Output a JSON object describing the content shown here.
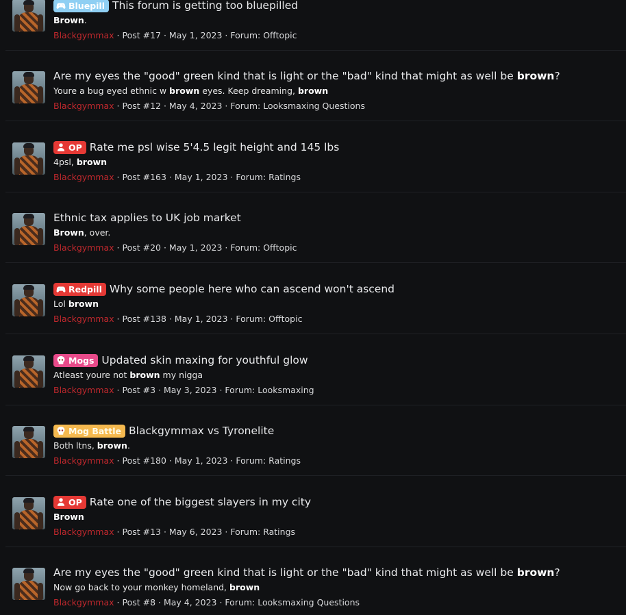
{
  "results": [
    {
      "prefix": {
        "label": "Bluepill",
        "icon": "gamepad-icon",
        "style": "bluepill",
        "color": "#8fcff3"
      },
      "title_parts": [
        {
          "text": "This forum is getting too bluepilled",
          "bold": false
        }
      ],
      "snippet_parts": [
        {
          "text": "Brown",
          "bold": true
        },
        {
          "text": ".",
          "bold": false
        }
      ],
      "author": "Blackgymmax",
      "post": "Post #17",
      "date": "May 1, 2023",
      "forum_label": "Forum:",
      "forum": "Offtopic"
    },
    {
      "prefix": null,
      "title_parts": [
        {
          "text": "Are my eyes the \"good\" green kind that is light or the \"bad\" kind that might as well be ",
          "bold": false
        },
        {
          "text": "brown",
          "bold": true
        },
        {
          "text": "?",
          "bold": false
        }
      ],
      "snippet_parts": [
        {
          "text": "Youre a bug eyed ethnic w ",
          "bold": false
        },
        {
          "text": "brown",
          "bold": true
        },
        {
          "text": " eyes. Keep dreaming, ",
          "bold": false
        },
        {
          "text": "brown",
          "bold": true
        }
      ],
      "author": "Blackgymmax",
      "post": "Post #12",
      "date": "May 4, 2023",
      "forum_label": "Forum:",
      "forum": "Looksmaxing Questions"
    },
    {
      "prefix": {
        "label": "OP",
        "icon": "user-icon",
        "style": "op",
        "color": "#e53935"
      },
      "title_parts": [
        {
          "text": "Rate me psl wise 5'4.5 legit height and 145 lbs",
          "bold": false
        }
      ],
      "snippet_parts": [
        {
          "text": "4psl, ",
          "bold": false
        },
        {
          "text": "brown",
          "bold": true
        }
      ],
      "author": "Blackgymmax",
      "post": "Post #163",
      "date": "May 1, 2023",
      "forum_label": "Forum:",
      "forum": "Ratings"
    },
    {
      "prefix": null,
      "title_parts": [
        {
          "text": "Ethnic tax applies to UK job market",
          "bold": false
        }
      ],
      "snippet_parts": [
        {
          "text": "Brown",
          "bold": true
        },
        {
          "text": ", over.",
          "bold": false
        }
      ],
      "author": "Blackgymmax",
      "post": "Post #20",
      "date": "May 1, 2023",
      "forum_label": "Forum:",
      "forum": "Offtopic"
    },
    {
      "prefix": {
        "label": "Redpill",
        "icon": "gamepad-icon",
        "style": "redpill",
        "color": "#e53935"
      },
      "title_parts": [
        {
          "text": "Why some people here who can ascend won't ascend",
          "bold": false
        }
      ],
      "snippet_parts": [
        {
          "text": "Lol ",
          "bold": false
        },
        {
          "text": "brown",
          "bold": true
        }
      ],
      "author": "Blackgymmax",
      "post": "Post #138",
      "date": "May 1, 2023",
      "forum_label": "Forum:",
      "forum": "Offtopic"
    },
    {
      "prefix": {
        "label": "Mogs",
        "icon": "skull-icon",
        "style": "mogs",
        "color": "#e84a8a"
      },
      "title_parts": [
        {
          "text": "Updated skin maxing for youthful glow",
          "bold": false
        }
      ],
      "snippet_parts": [
        {
          "text": "Atleast youre not ",
          "bold": false
        },
        {
          "text": "brown",
          "bold": true
        },
        {
          "text": " my nigga",
          "bold": false
        }
      ],
      "author": "Blackgymmax",
      "post": "Post #3",
      "date": "May 3, 2023",
      "forum_label": "Forum:",
      "forum": "Looksmaxing"
    },
    {
      "prefix": {
        "label": "Mog Battle",
        "icon": "skull-icon",
        "style": "mogbattle",
        "color": "#f5b94f"
      },
      "title_parts": [
        {
          "text": "Blackgymmax vs Tyronelite",
          "bold": false
        }
      ],
      "snippet_parts": [
        {
          "text": "Both ltns, ",
          "bold": false
        },
        {
          "text": "brown",
          "bold": true
        },
        {
          "text": ".",
          "bold": false
        }
      ],
      "author": "Blackgymmax",
      "post": "Post #180",
      "date": "May 1, 2023",
      "forum_label": "Forum:",
      "forum": "Ratings"
    },
    {
      "prefix": {
        "label": "OP",
        "icon": "user-icon",
        "style": "op",
        "color": "#e53935"
      },
      "title_parts": [
        {
          "text": "Rate one of the biggest slayers in my city",
          "bold": false
        }
      ],
      "snippet_parts": [
        {
          "text": "Brown",
          "bold": true
        }
      ],
      "author": "Blackgymmax",
      "post": "Post #13",
      "date": "May 6, 2023",
      "forum_label": "Forum:",
      "forum": "Ratings"
    },
    {
      "prefix": null,
      "title_parts": [
        {
          "text": "Are my eyes the \"good\" green kind that is light or the \"bad\" kind that might as well be ",
          "bold": false
        },
        {
          "text": "brown",
          "bold": true
        },
        {
          "text": "?",
          "bold": false
        }
      ],
      "snippet_parts": [
        {
          "text": "Now go back to your monkey homeland, ",
          "bold": false
        },
        {
          "text": "brown",
          "bold": true
        }
      ],
      "author": "Blackgymmax",
      "post": "Post #8",
      "date": "May 4, 2023",
      "forum_label": "Forum:",
      "forum": "Looksmaxing Questions"
    }
  ],
  "separator": " · "
}
